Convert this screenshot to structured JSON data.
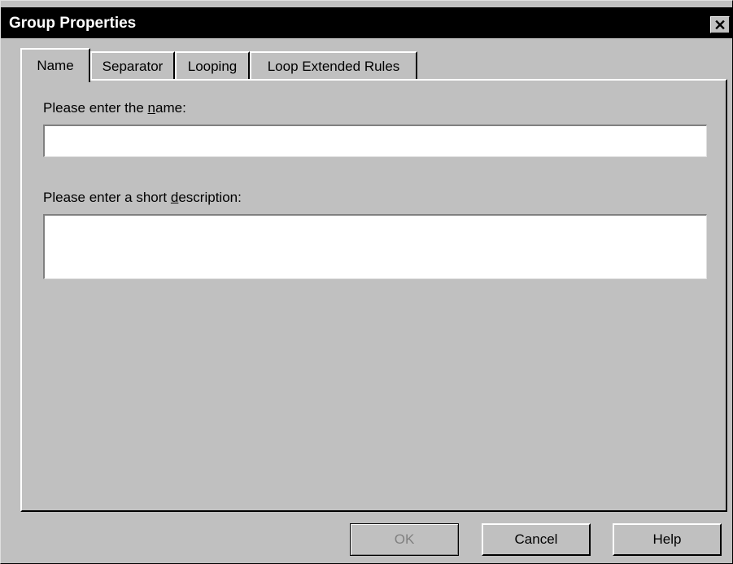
{
  "window": {
    "title": "Group Properties",
    "close_glyph": "✕"
  },
  "tabs": [
    {
      "label": "Name",
      "active": true
    },
    {
      "label": "Separator",
      "active": false
    },
    {
      "label": "Looping",
      "active": false
    },
    {
      "label": "Loop Extended Rules",
      "active": false
    }
  ],
  "form": {
    "name_label_pre": "Please enter the ",
    "name_label_accel": "n",
    "name_label_post": "ame:",
    "name_value": "",
    "desc_label_pre": "Please enter a short ",
    "desc_label_accel": "d",
    "desc_label_post": "escription:",
    "desc_value": ""
  },
  "buttons": {
    "ok": "OK",
    "cancel": "Cancel",
    "help": "Help"
  },
  "colors": {
    "face": "#c0c0c0",
    "titlebar": "#000000",
    "disabled_text": "#808080"
  }
}
